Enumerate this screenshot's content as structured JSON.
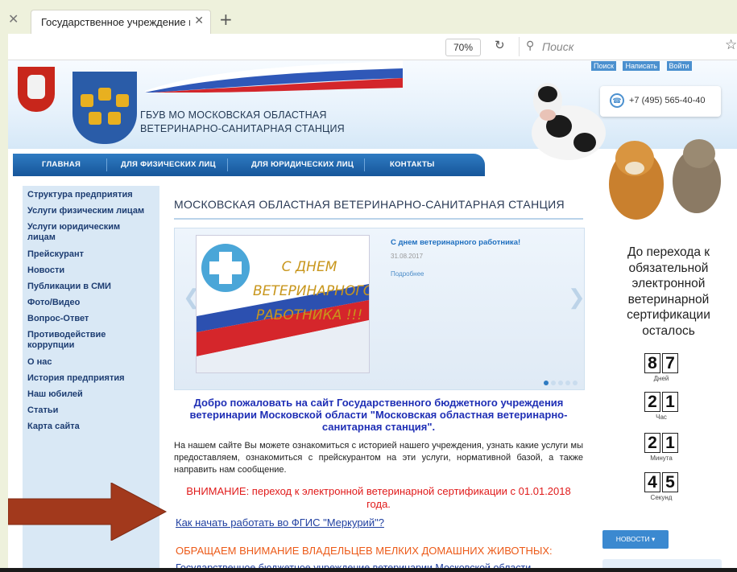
{
  "browser": {
    "tab_title": "Государственное учреждение в",
    "zoom": "70%",
    "search_placeholder": "Поиск"
  },
  "header": {
    "org_name": "ГБУВ МО МОСКОВСКАЯ ОБЛАСТНАЯ ВЕТЕРИНАРНО-САНИТАРНАЯ СТАНЦИЯ",
    "top_links": [
      "Поиск",
      "Написать",
      "Войти"
    ],
    "phone": "+7 (495) 565-40-40"
  },
  "nav": [
    "ГЛАВНАЯ",
    "ДЛЯ ФИЗИЧЕСКИХ ЛИЦ",
    "ДЛЯ ЮРИДИЧЕСКИХ ЛИЦ",
    "КОНТАКТЫ"
  ],
  "sidebar": [
    "Структура предприятия",
    "Услуги физическим лицам",
    "Услуги юридическим лицам",
    "Прейскурант",
    "Новости",
    "Публикации в СМИ",
    "Фото/Видео",
    "Вопрос-Ответ",
    "Противодействие коррупции",
    "О нас",
    "История предприятия",
    "Наш юбилей",
    "Статьи",
    "Карта сайта"
  ],
  "main": {
    "title": "МОСКОВСКАЯ ОБЛАСТНАЯ ВЕТЕРИНАРНО-САНИТАРНАЯ СТАНЦИЯ",
    "slide": {
      "image_text": "С ДНЕМ ВЕТЕРИНАРНОГО РАБОТНИКА !!!",
      "headline": "С днем ветеринарного работника!",
      "date": "31.08.2017",
      "more": "Подробнее"
    },
    "welcome": "Добро пожаловать на сайт Государственного бюджетного учреждения ветеринарии Московской области \"Московская областная ветеринарно-санитарная станция\".",
    "intro": "На нашем сайте Вы можете ознакомиться с историей нашего учреждения, узнать какие услуги мы предоставляем, ознакомиться с прейскурантом на эти услуги, нормативной базой, а также направить нам сообщение.",
    "warning": "ВНИМАНИЕ: переход к электронной ветеринарной сертификации с 01.01.2018 года.",
    "mercury_link": "Как начать работать во ФГИС \"Меркурий\"?",
    "attention": "ОБРАЩАЕМ ВНИМАНИЕ ВЛАДЕЛЬЦЕВ МЕЛКИХ ДОМАШНИХ ЖИВОТНЫХ:",
    "cut_text": "Государственное бюджетное учреждение ветеринарии Московской области"
  },
  "countdown": {
    "title": "До перехода к обязательной электронной ветеринарной сертификации осталось",
    "units": [
      {
        "value": "87",
        "label": "Дней"
      },
      {
        "value": "21",
        "label": "Час"
      },
      {
        "value": "21",
        "label": "Минута"
      },
      {
        "value": "45",
        "label": "Секунд"
      }
    ]
  },
  "news_button": "НОВОСТИ ▾",
  "colors": {
    "nav": "#1f66ad",
    "warning": "#e01a1a",
    "attention": "#ec5a18",
    "welcome": "#1f2fb5",
    "arrow": "#a2391c"
  }
}
